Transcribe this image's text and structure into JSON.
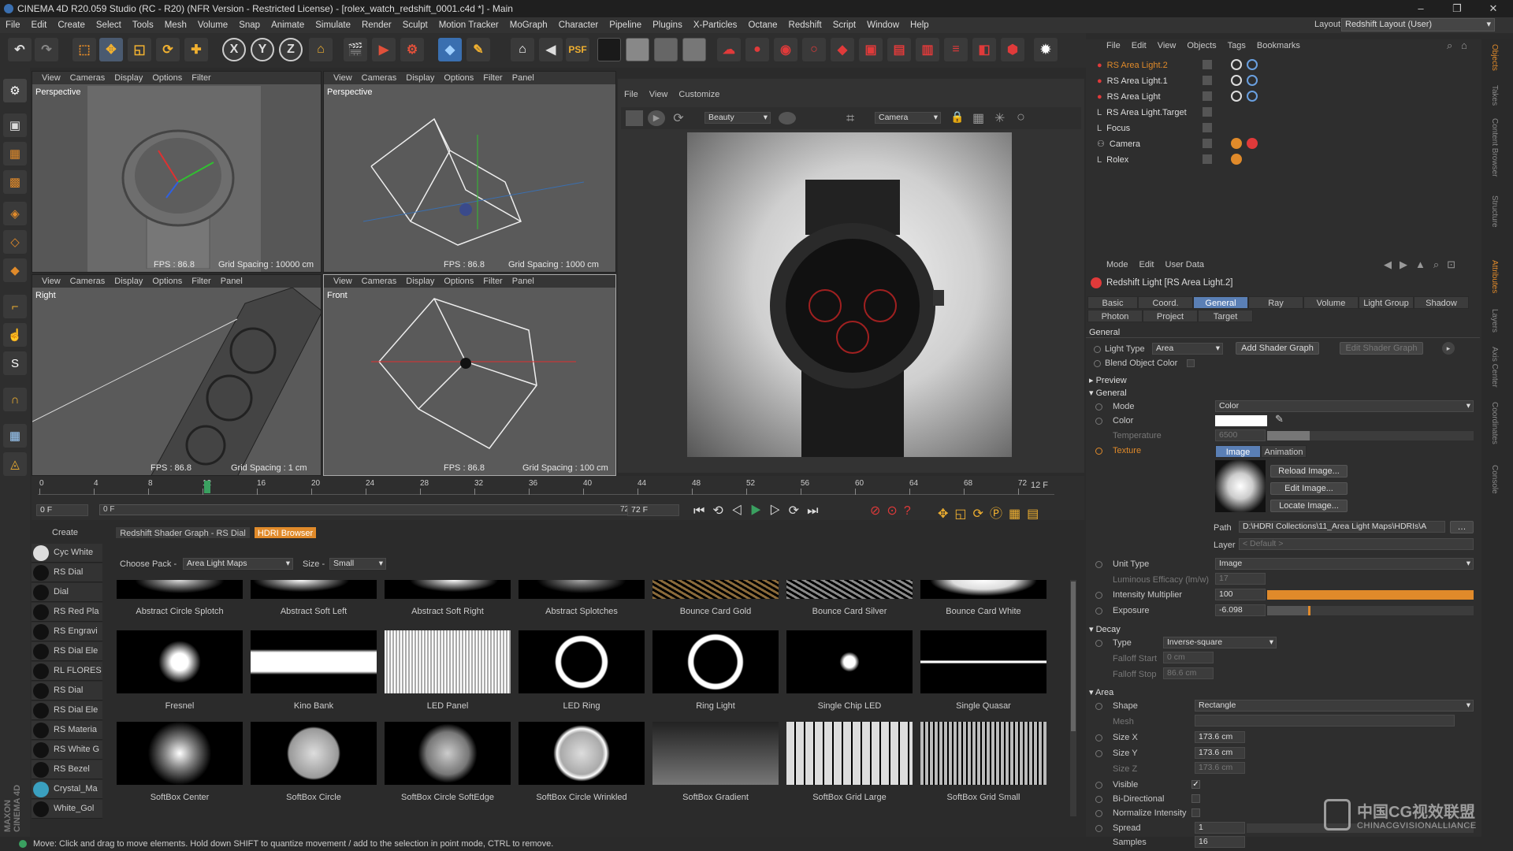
{
  "window": {
    "title": "CINEMA 4D R20.059 Studio (RC - R20) (NFR Version - Restricted License) - [rolex_watch_redshift_0001.c4d *] - Main",
    "minimize": "–",
    "maximize": "❐",
    "close": "✕"
  },
  "menu": [
    "File",
    "Edit",
    "Create",
    "Select",
    "Tools",
    "Mesh",
    "Volume",
    "Snap",
    "Animate",
    "Simulate",
    "Render",
    "Sculpt",
    "Motion Tracker",
    "MoGraph",
    "Character",
    "Pipeline",
    "Plugins",
    "X-Particles",
    "Octane",
    "Redshift",
    "Script",
    "Window",
    "Help"
  ],
  "layout": {
    "label": "Layout:",
    "value": "Redshift Layout (User)"
  },
  "toolbar": {
    "x": "X",
    "y": "Y",
    "z": "Z",
    "psf": "PSF"
  },
  "viewports": {
    "menu": [
      "View",
      "Cameras",
      "Display",
      "Options",
      "Filter",
      "Panel"
    ],
    "perspective1": {
      "label": "Perspective",
      "fps": "FPS : 86.8",
      "grid": "Grid Spacing : 10000 cm"
    },
    "perspective2": {
      "label": "Perspective",
      "fps": "FPS : 86.8",
      "grid": "Grid Spacing : 1000 cm"
    },
    "right": {
      "label": "Right",
      "fps": "FPS : 86.8",
      "grid": "Grid Spacing : 1 cm"
    },
    "front": {
      "label": "Front",
      "fps": "FPS : 86.8",
      "grid": "Grid Spacing : 100 cm"
    }
  },
  "picture_viewer": {
    "menu": [
      "File",
      "View",
      "Customize"
    ],
    "aov": "Beauty",
    "camera": "Camera"
  },
  "timeline": {
    "ticks": [
      "0",
      "4",
      "8",
      "12",
      "16",
      "20",
      "24",
      "28",
      "32",
      "36",
      "40",
      "44",
      "48",
      "52",
      "56",
      "60",
      "64",
      "68",
      "72"
    ],
    "current": "12",
    "end": "12 F",
    "start_field": "0 F",
    "range_start": "0 F",
    "range_end": "72 F",
    "max_field": "72 F"
  },
  "materials": {
    "create": "Create",
    "items": [
      "Cyc White",
      "RS Dial",
      "Dial",
      "RS Red Pla",
      "RS Engravi",
      "RS Dial Ele",
      "RL FLORES",
      "RS Dial",
      "RS Dial Ele",
      "RS Materia",
      "RS White G",
      "RS Bezel",
      "Crystal_Ma",
      "White_Gol"
    ]
  },
  "hdri": {
    "tabs": [
      "Redshift Shader Graph - RS Dial",
      "HDRI Browser"
    ],
    "choose_pack": "Choose Pack -",
    "pack": "Area Light Maps",
    "size_label": "Size -",
    "size": "Small",
    "row1": [
      "Abstract Circle Splotch",
      "Abstract Soft Left",
      "Abstract Soft Right",
      "Abstract Splotches",
      "Bounce Card Gold",
      "Bounce Card Silver",
      "Bounce Card White"
    ],
    "row2": [
      "Fresnel",
      "Kino Bank",
      "LED Panel",
      "LED Ring",
      "Ring Light",
      "Single Chip LED",
      "Single Quasar"
    ],
    "row3": [
      "SoftBox Center",
      "SoftBox Circle",
      "SoftBox Circle SoftEdge",
      "SoftBox Circle Wrinkled",
      "SoftBox Gradient",
      "SoftBox Grid Large",
      "SoftBox Grid Small"
    ]
  },
  "objects": {
    "menu": [
      "File",
      "Edit",
      "View",
      "Objects",
      "Tags",
      "Bookmarks"
    ],
    "items": [
      "RS Area Light.2",
      "RS Area Light.1",
      "RS Area Light",
      "RS Area Light.Target",
      "Focus",
      "Camera",
      "Rolex"
    ]
  },
  "attributes": {
    "menu": [
      "Mode",
      "Edit",
      "User Data"
    ],
    "title": "Redshift Light [RS Area Light.2]",
    "tabs1": [
      "Basic",
      "Coord.",
      "General",
      "Ray",
      "Volume",
      "Light Group",
      "Shadow"
    ],
    "tabs2": [
      "Photon",
      "Project",
      "Target"
    ],
    "general_header": "General",
    "light_type_label": "Light Type",
    "light_type": "Area",
    "add_shader": "Add Shader Graph",
    "edit_shader": "Edit Shader Graph",
    "blend": "Blend Object Color",
    "preview": "Preview",
    "general2": "General",
    "mode_label": "Mode",
    "mode": "Color",
    "color_label": "Color",
    "temp_label": "Temperature",
    "temp": "6500",
    "texture_label": "Texture",
    "tex_tabs": [
      "Image",
      "Animation"
    ],
    "reload": "Reload Image...",
    "edit_img": "Edit Image...",
    "locate": "Locate Image...",
    "path_label": "Path",
    "path": "D:\\HDRI Collections\\11_Area Light Maps\\HDRIs\\A",
    "layer_label": "Layer",
    "layer": "< Default >",
    "unit_label": "Unit Type",
    "unit": "Image",
    "lum_label": "Luminous Efficacy (lm/w)",
    "lum": "17",
    "int_label": "Intensity Multiplier",
    "int": "100",
    "exp_label": "Exposure",
    "exp": "-6.098",
    "decay": "Decay",
    "type_label": "Type",
    "type": "Inverse-square",
    "fstart_label": "Falloff Start",
    "fstart": "0 cm",
    "fstop_label": "Falloff Stop",
    "fstop": "86.6 cm",
    "area": "Area",
    "shape_label": "Shape",
    "shape": "Rectangle",
    "mesh_label": "Mesh",
    "sx_label": "Size X",
    "sx": "173.6 cm",
    "sy_label": "Size Y",
    "sy": "173.6 cm",
    "sz_label": "Size Z",
    "sz": "173.6 cm",
    "visible": "Visible",
    "bidir": "Bi-Directional",
    "normalize": "Normalize Intensity",
    "spread_label": "Spread",
    "spread": "1",
    "samples_label": "Samples",
    "samples": "16"
  },
  "side_tabs": [
    "Objects",
    "Takes",
    "Content Browser",
    "Structure",
    "Attributes",
    "Layers",
    "Axis Center",
    "Coordinates",
    "Console"
  ],
  "watermark": {
    "cn": "中国CG视效联盟",
    "en": "CHINACGVISIONALLIANCE"
  },
  "status": "Move: Click and drag to move elements. Hold down SHIFT to quantize movement / add to the selection in point mode, CTRL to remove."
}
